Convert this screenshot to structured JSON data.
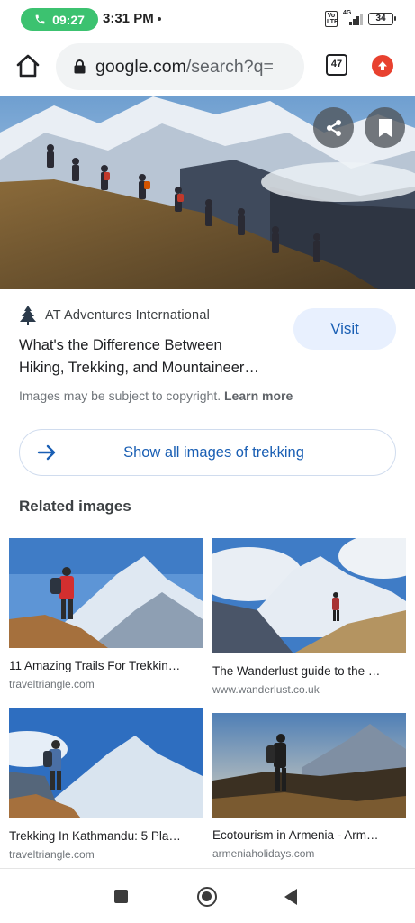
{
  "status_bar": {
    "call_timer": "09:27",
    "time": "3:31 PM",
    "volte_label": "Vo LTE",
    "network_type": "4G",
    "battery_level": "34"
  },
  "browser": {
    "url_domain": "google.com",
    "url_path": "/search?q=",
    "tab_count": "47"
  },
  "result": {
    "source_name": "AT Adventures International",
    "title_line1": "What's the Difference Between",
    "title_line2": "Hiking, Trekking, and Mountaineer…",
    "visit_label": "Visit",
    "copyright_text": "Images may be subject to copyright.",
    "learn_more_label": "Learn more",
    "show_all_label": "Show all images of trekking"
  },
  "related": {
    "heading": "Related images",
    "items": [
      {
        "caption": "11 Amazing Trails For Trekkin…",
        "site": "traveltriangle.com"
      },
      {
        "caption": "The Wanderlust guide to the …",
        "site": "www.wanderlust.co.uk"
      },
      {
        "caption": "Trekking In Kathmandu: 5 Pla…",
        "site": "traveltriangle.com"
      },
      {
        "caption": "Ecotourism in Armenia - Arm…",
        "site": "armeniaholidays.com"
      }
    ]
  },
  "colors": {
    "call_pill": "#3cc270",
    "link_blue": "#1a5fb4",
    "visit_bg": "#e8f0fe",
    "update_red": "#e8412f"
  },
  "icons": [
    "phone-icon",
    "home-icon",
    "lock-icon",
    "tabs-icon",
    "update-icon",
    "share-icon",
    "bookmark-icon",
    "tree-logo-icon",
    "arrow-right-icon",
    "recents-icon",
    "home-nav-icon",
    "back-icon"
  ]
}
